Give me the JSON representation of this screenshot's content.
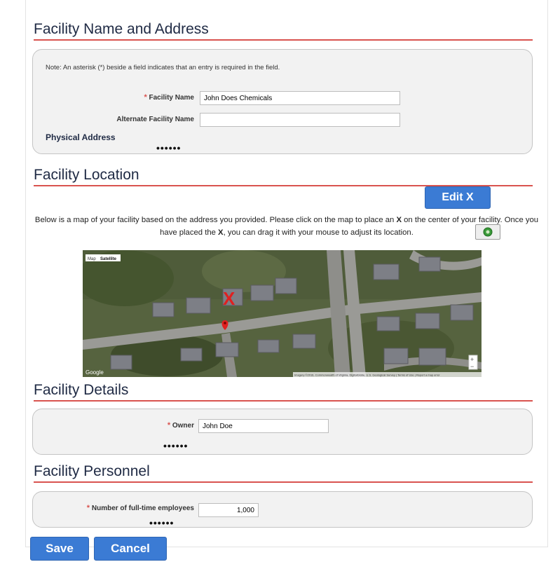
{
  "sections": {
    "name_address": {
      "title": "Facility Name and Address",
      "note": "Note: An asterisk (*) beside a field indicates that an entry is required in the field.",
      "required_mark": "*",
      "facility_name_label": "Facility Name",
      "facility_name_value": "John Does Chemicals",
      "alt_name_label": "Alternate Facility Name",
      "alt_name_value": "",
      "physical_address_heading": "Physical Address",
      "collapsed": "••••••"
    },
    "location": {
      "title": "Facility Location",
      "edit_button": "Edit X",
      "description_1": "Below is a map of your facility based on the address you provided. Please click on the map to place an ",
      "description_x1": "X",
      "description_2": " on the center of your facility. Once you have placed the ",
      "description_x2": "X",
      "description_3": ", you can drag it with your mouse to adjust its location.",
      "map": {
        "type_map": "Map",
        "type_satellite": "Satellite",
        "brand": "Google",
        "attribution": "Imagery ©2016, Commonwealth of Virginia, DigitalGlobe, U.S. Geological Survey | Terms of Use | Report a map error",
        "zoom_in": "+",
        "zoom_out": "−",
        "marker": "X"
      }
    },
    "details": {
      "title": "Facility Details",
      "required_mark": "*",
      "owner_label": "Owner",
      "owner_value": "John Doe",
      "collapsed": "••••••"
    },
    "personnel": {
      "title": "Facility Personnel",
      "required_mark": "*",
      "employees_label": "Number of full-time employees",
      "employees_value": "1,000",
      "collapsed": "••••••"
    }
  },
  "actions": {
    "save": "Save",
    "cancel": "Cancel"
  },
  "colors": {
    "accent_red": "#d9534f",
    "button_blue": "#3b7bd4",
    "title_navy": "#1f2a44"
  }
}
